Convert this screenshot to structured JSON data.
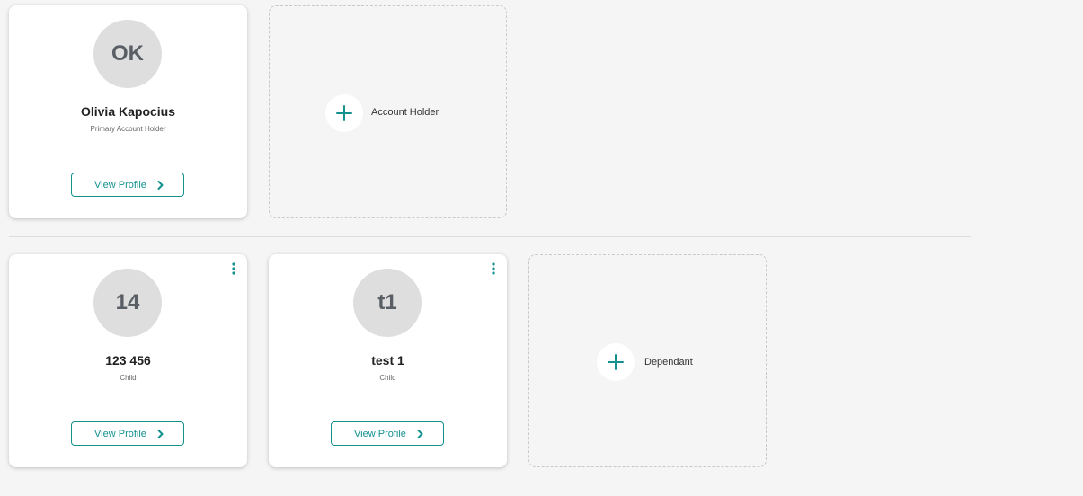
{
  "accent_color": "#13918f",
  "account_holders": [
    {
      "initials": "OK",
      "name": "Olivia Kapocius",
      "role": "Primary Account Holder",
      "view_label": "View Profile"
    }
  ],
  "add_account_holder": {
    "label": "Account Holder",
    "icon": "plus-icon"
  },
  "dependants": [
    {
      "initials": "14",
      "name": "123 456",
      "role": "Child",
      "view_label": "View Profile"
    },
    {
      "initials": "t1",
      "name": "test 1",
      "role": "Child",
      "view_label": "View Profile"
    }
  ],
  "add_dependant": {
    "label": "Dependant",
    "icon": "plus-icon"
  }
}
